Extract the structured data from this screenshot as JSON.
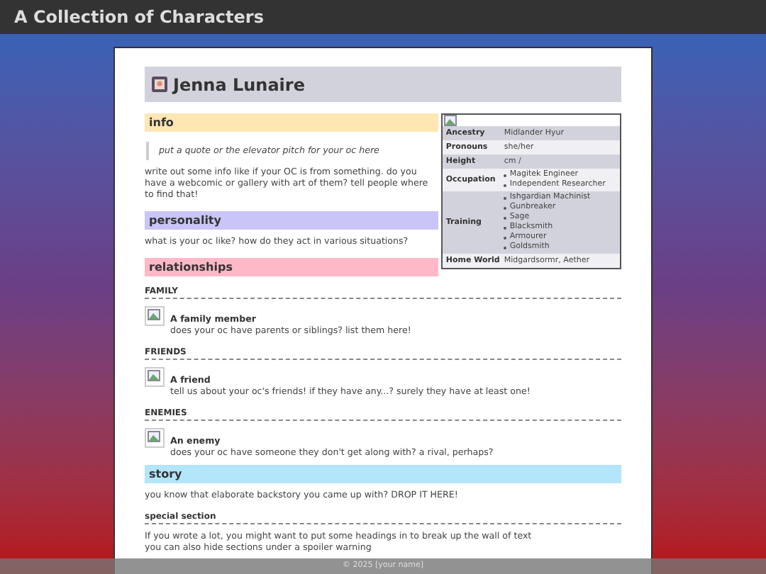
{
  "site_title": "A Collection of Characters",
  "character": {
    "name": "Jenna Lunaire"
  },
  "info": {
    "heading": "info",
    "quote": "put a quote or the elevator pitch for your oc here",
    "text": "write out some info like if your OC is from something. do you have a webcomic or gallery with art of them? tell people where to find that!"
  },
  "personality": {
    "heading": "personality",
    "text": "what is your oc like? how do they act in various situations?"
  },
  "infobox": [
    {
      "label": "Ancestry",
      "value": "Midlander Hyur"
    },
    {
      "label": "Pronouns",
      "value": "she/her"
    },
    {
      "label": "Height",
      "value": "cm /"
    },
    {
      "label": "Occupation",
      "items": [
        "Magitek Engineer",
        "Independent Researcher"
      ]
    },
    {
      "label": "Training",
      "items": [
        "Ishgardian Machinist",
        "Gunbreaker",
        "Sage",
        "Blacksmith",
        "Armourer",
        "Goldsmith"
      ]
    },
    {
      "label": "Home World",
      "value": "Midgardsormr, Aether"
    }
  ],
  "relationships": {
    "heading": "relationships",
    "groups": [
      {
        "title": "FAMILY",
        "name": "A family member",
        "text": "does your oc have parents or siblings? list them here!"
      },
      {
        "title": "FRIENDS",
        "name": "A friend",
        "text": "tell us about your oc's friends! if they have any...? surely they have at least one!"
      },
      {
        "title": "ENEMIES",
        "name": "An enemy",
        "text": "does your oc have someone they don't get along with? a rival, perhaps?"
      }
    ]
  },
  "story": {
    "heading": "story",
    "text": "you know that elaborate backstory you came up with? DROP IT HERE!",
    "subheading": "special section",
    "lines": [
      "If you wrote a lot, you might want to put some headings in to break up the wall of text",
      "you can also hide sections under a spoiler warning"
    ]
  },
  "footer": "© 2025 [your name]"
}
